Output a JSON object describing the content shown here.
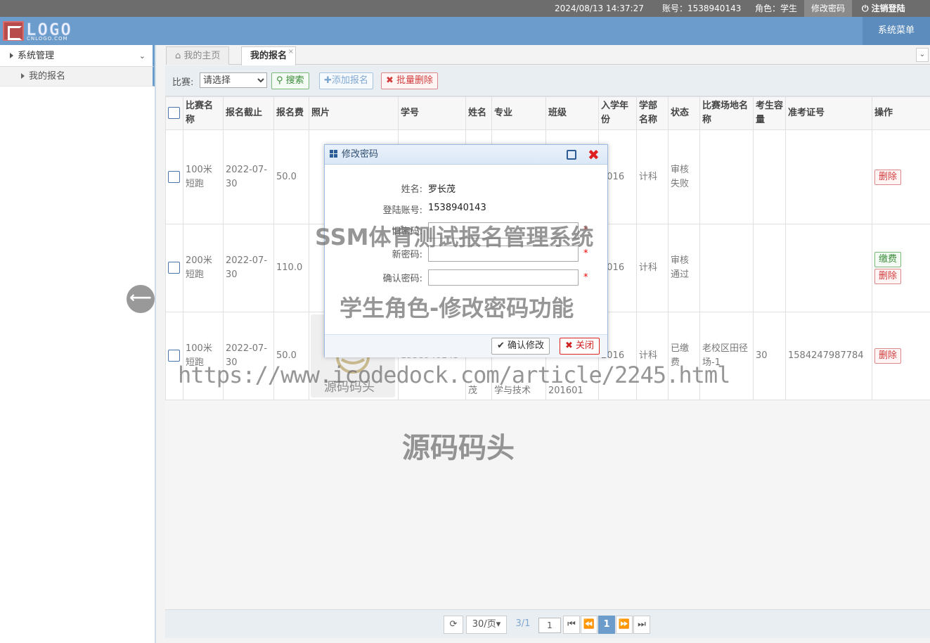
{
  "topbar": {
    "datetime": "2024/08/13 14:37:27",
    "account": "账号：1538940143",
    "role": "角色：学生",
    "change_password": "修改密码",
    "logout": "注销登陆"
  },
  "header": {
    "logo_text": "LOGO",
    "logo_sub": "CNLOGO.COM",
    "system_menu": "系统菜单"
  },
  "sidebar": {
    "title": "系统管理",
    "items": [
      {
        "label": "我的报名"
      }
    ]
  },
  "tabs": [
    {
      "label": "我的主页"
    },
    {
      "label": "我的报名"
    }
  ],
  "toolbar": {
    "match_label": "比赛:",
    "match_select": "请选择",
    "search": "搜索",
    "add": "添加报名",
    "batch_delete": "批量删除"
  },
  "table": {
    "headers": [
      "比赛名称",
      "报名截止",
      "报名费",
      "照片",
      "学号",
      "姓名",
      "专业",
      "班级",
      "入学年份",
      "学部名称",
      "状态",
      "比赛场地名称",
      "考生容量",
      "准考证号",
      "操作"
    ],
    "rows": [
      {
        "match": "100米短跑",
        "deadline": "2022-07-30",
        "fee": "50.0",
        "year": "2016",
        "dept": "计科",
        "status": "审核失败",
        "venue": "",
        "capacity": "",
        "ticket": "",
        "ops": [
          "删除"
        ]
      },
      {
        "match": "200米短跑",
        "deadline": "2022-07-30",
        "fee": "110.0",
        "year": "2016",
        "dept": "计科",
        "status": "审核通过",
        "venue": "",
        "capacity": "",
        "ticket": "",
        "ops": [
          "缴费",
          "删除"
        ]
      },
      {
        "match": "100米短跑",
        "deadline": "2022-07-30",
        "fee": "50.0",
        "student_no": "1538940143",
        "name": "茂",
        "major": "学与技术",
        "class": "201601",
        "year": "2016",
        "dept": "计科",
        "status": "已缴费",
        "venue": "老校区田径场-1",
        "capacity": "30",
        "ticket": "1584247987784",
        "ops": [
          "删除"
        ]
      }
    ]
  },
  "pager": {
    "page_size": "30/页",
    "page_info": "3/1",
    "page_input": "1",
    "current_page": "1"
  },
  "modal": {
    "title": "修改密码",
    "name_label": "姓名:",
    "name_value": "罗长茂",
    "account_label": "登陆账号:",
    "account_value": "1538940143",
    "old_password_label": "旧密码:",
    "new_password_label": "新密码:",
    "confirm_password_label": "确认密码:",
    "required_mark": "*",
    "confirm_button": "确认修改",
    "close_button": "关闭"
  },
  "watermarks": {
    "system_title": "SSM体育测试报名管理系统",
    "feature": "学生角色-修改密码功能",
    "url": "https://www.icodedock.com/article/2245.html",
    "brand": "源码码头",
    "thumb_caption": "源码码头"
  },
  "colors": {
    "header_blue": "#6b9ccb",
    "topbar_gray": "#6d6d6d",
    "danger": "#d23c3c",
    "success": "#3c8d3c"
  }
}
